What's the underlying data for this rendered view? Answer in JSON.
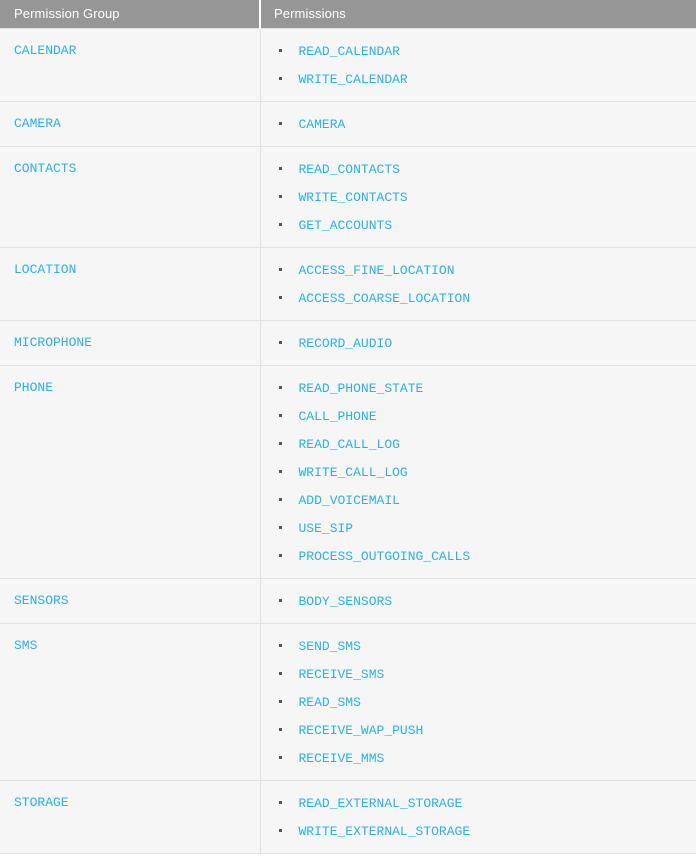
{
  "table": {
    "columns": [
      {
        "id": "permission_group",
        "label": "Permission Group"
      },
      {
        "id": "permissions",
        "label": "Permissions"
      }
    ],
    "colors": {
      "header_background": "#969696",
      "header_text": "#ffffff",
      "row_background": "#f6f6f6",
      "link_text": "#29b0ee",
      "border": "#e2e2e2",
      "bullet": "#555555"
    },
    "rows": [
      {
        "group": "CALENDAR",
        "permissions": [
          "READ_CALENDAR",
          "WRITE_CALENDAR"
        ]
      },
      {
        "group": "CAMERA",
        "permissions": [
          "CAMERA"
        ]
      },
      {
        "group": "CONTACTS",
        "permissions": [
          "READ_CONTACTS",
          "WRITE_CONTACTS",
          "GET_ACCOUNTS"
        ]
      },
      {
        "group": "LOCATION",
        "permissions": [
          "ACCESS_FINE_LOCATION",
          "ACCESS_COARSE_LOCATION"
        ]
      },
      {
        "group": "MICROPHONE",
        "permissions": [
          "RECORD_AUDIO"
        ]
      },
      {
        "group": "PHONE",
        "permissions": [
          "READ_PHONE_STATE",
          "CALL_PHONE",
          "READ_CALL_LOG",
          "WRITE_CALL_LOG",
          "ADD_VOICEMAIL",
          "USE_SIP",
          "PROCESS_OUTGOING_CALLS"
        ]
      },
      {
        "group": "SENSORS",
        "permissions": [
          "BODY_SENSORS"
        ]
      },
      {
        "group": "SMS",
        "permissions": [
          "SEND_SMS",
          "RECEIVE_SMS",
          "READ_SMS",
          "RECEIVE_WAP_PUSH",
          "RECEIVE_MMS"
        ]
      },
      {
        "group": "STORAGE",
        "permissions": [
          "READ_EXTERNAL_STORAGE",
          "WRITE_EXTERNAL_STORAGE"
        ]
      }
    ]
  }
}
